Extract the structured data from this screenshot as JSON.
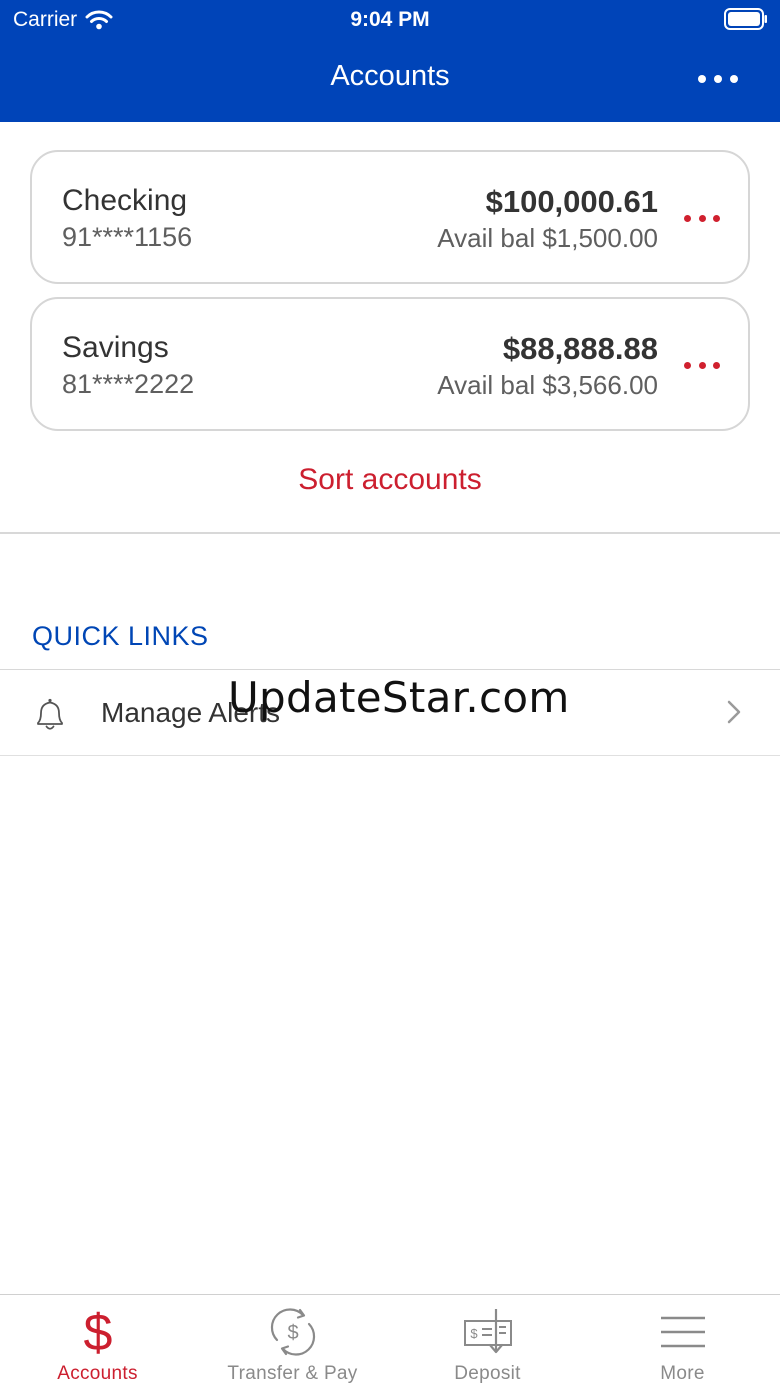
{
  "status_bar": {
    "carrier": "Carrier",
    "time": "9:04 PM"
  },
  "header": {
    "title": "Accounts"
  },
  "accounts": [
    {
      "name": "Checking",
      "number": "91****1156",
      "balance": "$100,000.61",
      "available": "Avail bal $1,500.00"
    },
    {
      "name": "Savings",
      "number": "81****2222",
      "balance": "$88,888.88",
      "available": "Avail bal $3,566.00"
    }
  ],
  "sort_label": "Sort accounts",
  "quick_links": {
    "title": "QUICK LINKS",
    "items": [
      {
        "label": "Manage Alerts",
        "icon": "bell-icon"
      }
    ]
  },
  "watermark": "UpdateStar.com",
  "tabs": [
    {
      "label": "Accounts",
      "icon": "dollar-icon",
      "active": true
    },
    {
      "label": "Transfer & Pay",
      "icon": "transfer-icon",
      "active": false
    },
    {
      "label": "Deposit",
      "icon": "check-deposit-icon",
      "active": false
    },
    {
      "label": "More",
      "icon": "menu-icon",
      "active": false
    }
  ],
  "colors": {
    "header": "#0044b8",
    "accent_red": "#cc1f2f",
    "link_blue": "#0046b5"
  }
}
